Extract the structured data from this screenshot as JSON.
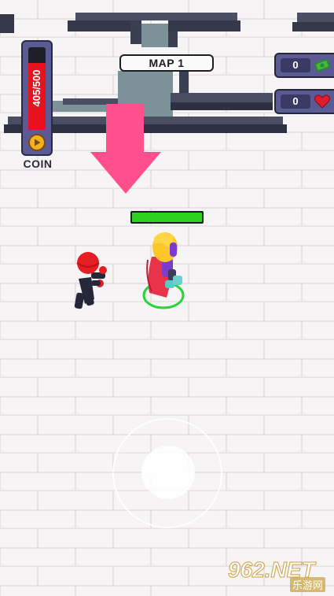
{
  "hud": {
    "map_label": "MAP 1",
    "coin_bar": {
      "text": "405/500",
      "current": 405,
      "max": 500
    },
    "coin_caption": "COIN",
    "cash_count": "0",
    "heart_count": "0"
  },
  "player": {
    "health_fraction": 1.0
  },
  "colors": {
    "arrow": "#ff4f8c",
    "health": "#2fd11f",
    "coin_fill": "#e8121e",
    "panel": "#5a5a94",
    "enemy_body": "#26283a",
    "enemy_head": "#e61d22",
    "hero_hair": "#ffc629",
    "hero_cape": "#e8344a",
    "player_ring": "#2ad43a"
  },
  "icons": {
    "coin_button": "play-icon",
    "cash": "money-icon",
    "heart": "heart-icon",
    "arrow": "arrow-down-icon"
  },
  "watermark": {
    "number": "962.NET",
    "subtitle": "乐游网"
  }
}
